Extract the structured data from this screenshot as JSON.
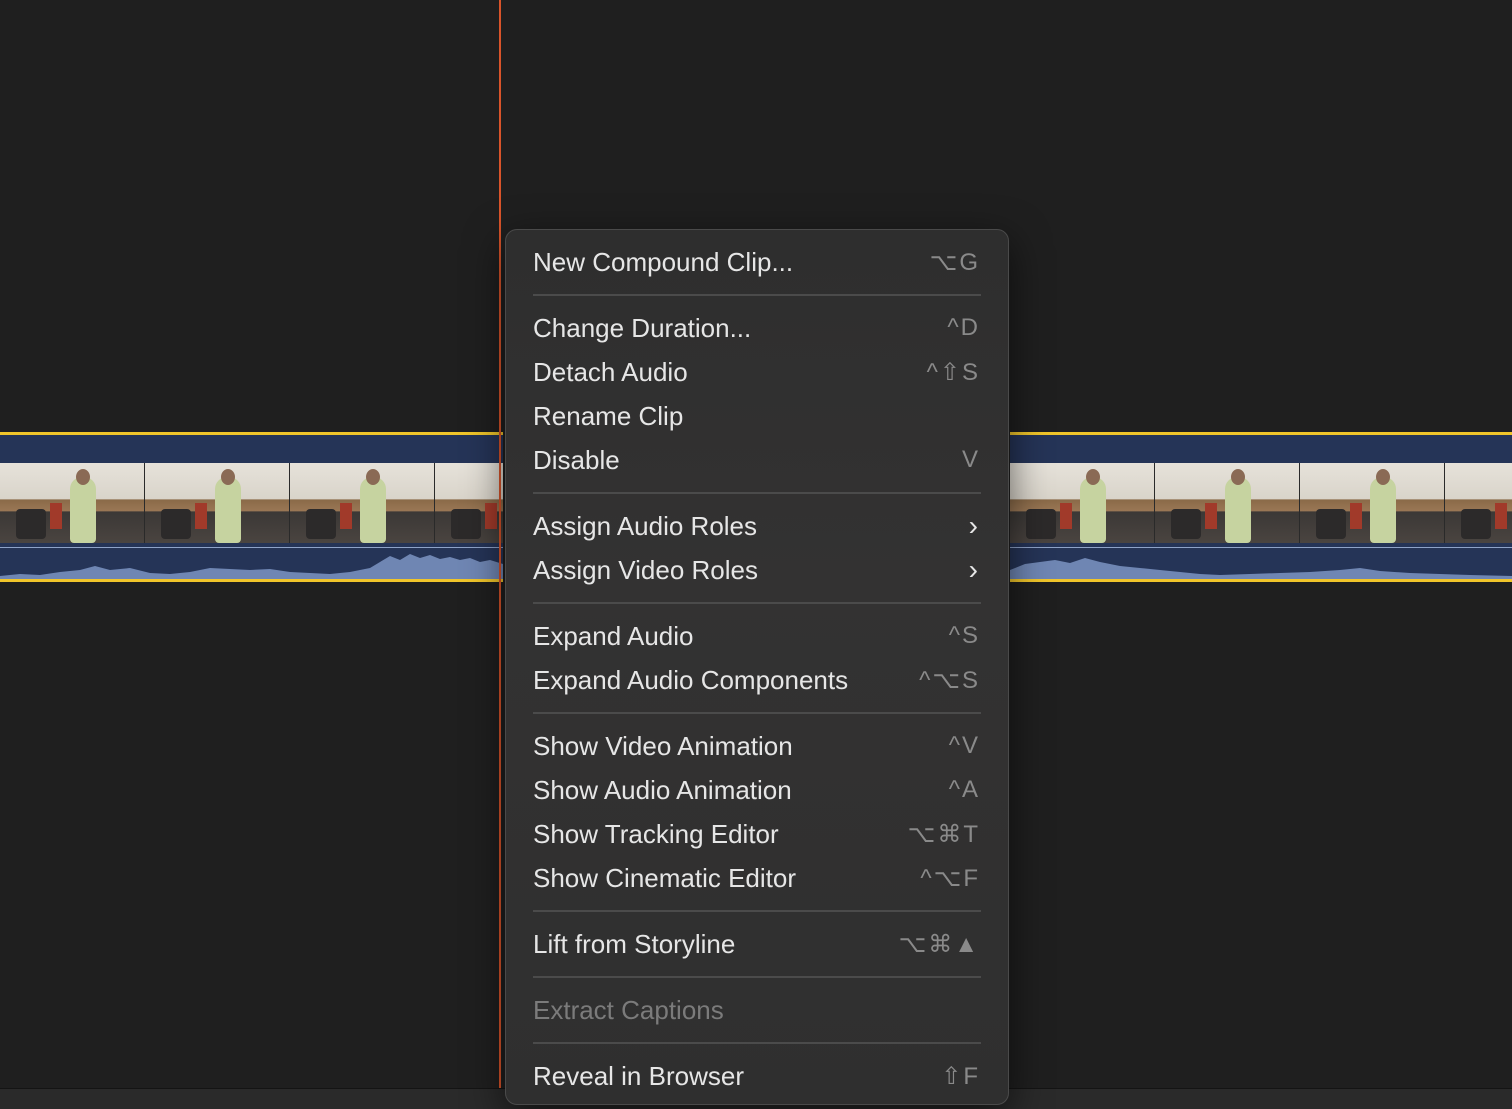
{
  "colors": {
    "accent_playhead": "#d9542a",
    "clip_selection": "#f0c52a",
    "clip_body": "#253457",
    "menu_bg": "#2f2f2f"
  },
  "timeline": {
    "thumbnail_count_left": 4,
    "thumbnail_count_right": 4
  },
  "menu": {
    "groups": [
      [
        {
          "label": "New Compound Clip...",
          "shortcut": "⌥G"
        }
      ],
      [
        {
          "label": "Change Duration...",
          "shortcut": "^D"
        },
        {
          "label": "Detach Audio",
          "shortcut": "^⇧S"
        },
        {
          "label": "Rename Clip",
          "shortcut": ""
        },
        {
          "label": "Disable",
          "shortcut": "V"
        }
      ],
      [
        {
          "label": "Assign Audio Roles",
          "submenu": true
        },
        {
          "label": "Assign Video Roles",
          "submenu": true
        }
      ],
      [
        {
          "label": "Expand Audio",
          "shortcut": "^S"
        },
        {
          "label": "Expand Audio Components",
          "shortcut": "^⌥S"
        }
      ],
      [
        {
          "label": "Show Video Animation",
          "shortcut": "^V"
        },
        {
          "label": "Show Audio Animation",
          "shortcut": "^A"
        },
        {
          "label": "Show Tracking Editor",
          "shortcut": "⌥⌘T"
        },
        {
          "label": "Show Cinematic Editor",
          "shortcut": "^⌥F"
        }
      ],
      [
        {
          "label": "Lift from Storyline",
          "shortcut": "⌥⌘▲"
        }
      ],
      [
        {
          "label": "Extract Captions",
          "shortcut": "",
          "disabled": true
        }
      ],
      [
        {
          "label": "Reveal in Browser",
          "shortcut": "⇧F"
        }
      ]
    ]
  }
}
